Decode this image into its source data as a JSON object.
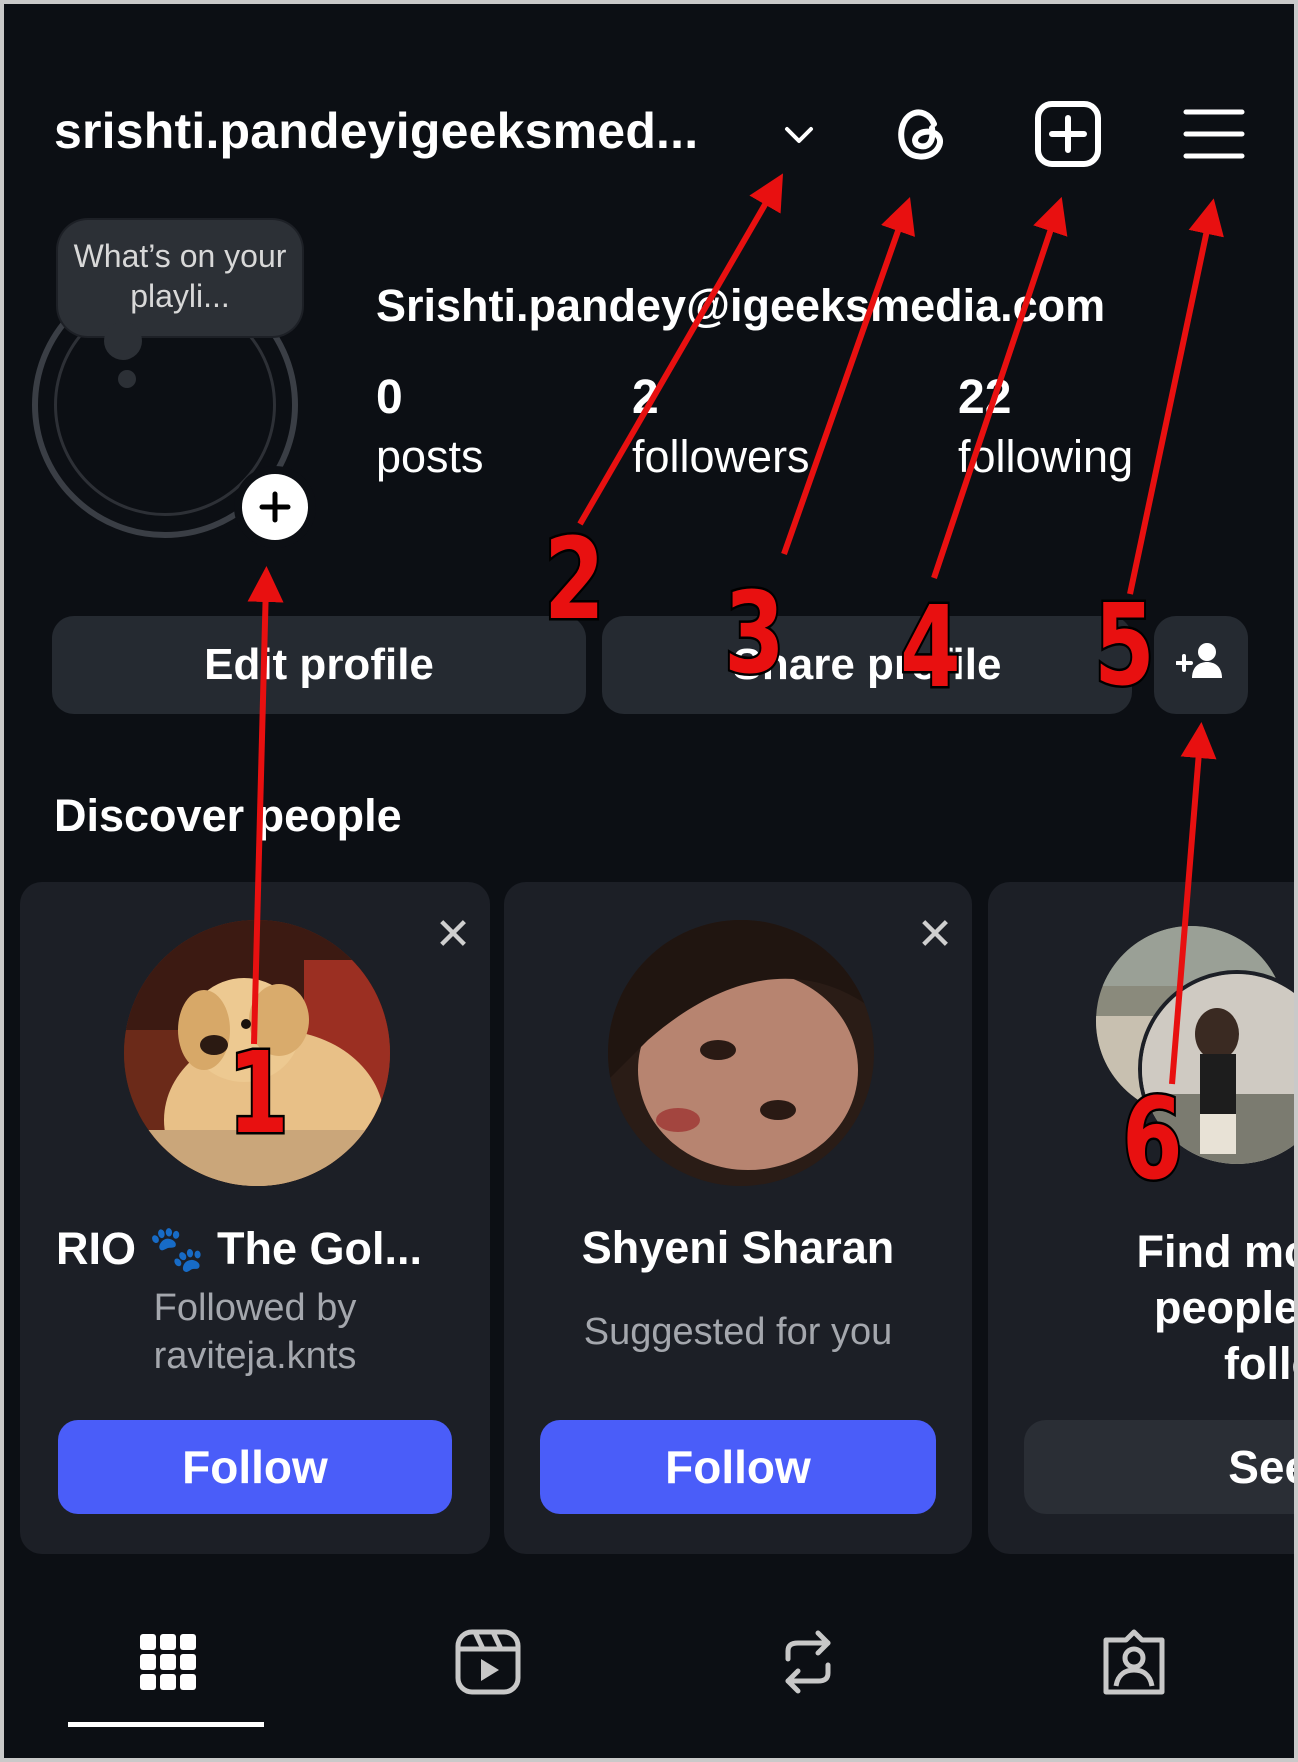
{
  "header": {
    "username": "srishti.pandeyigeeksmed...",
    "icons": [
      "chevron-down-icon",
      "threads-icon",
      "create-post-icon",
      "menu-icon"
    ]
  },
  "profile": {
    "note_text": "What’s on your playli...",
    "display_name": "Srishti.pandey@igeeksmedia.com",
    "stats": [
      {
        "value": "0",
        "label": "posts"
      },
      {
        "value": "2",
        "label": "followers"
      },
      {
        "value": "22",
        "label": "following"
      }
    ]
  },
  "actions": {
    "edit_profile": "Edit profile",
    "share_profile": "Share profile"
  },
  "discover": {
    "title": "Discover people",
    "cards": [
      {
        "name": "RIO 🐾 The Gol...",
        "subtitle": "Followed by raviteja.knts",
        "button": "Follow"
      },
      {
        "name": "Shyeni Sharan",
        "subtitle": "Suggested for you",
        "button": "Follow"
      },
      {
        "name": "Find more people to follow",
        "button": "See all"
      }
    ]
  },
  "tabs": [
    "grid-icon",
    "reels-icon",
    "reposts-icon",
    "tagged-icon"
  ],
  "annotations": [
    "1",
    "2",
    "3",
    "4",
    "5",
    "6"
  ],
  "colors": {
    "background": "#0c0f14",
    "follow_button": "#4a5df9",
    "annotation_red": "#e81010"
  }
}
